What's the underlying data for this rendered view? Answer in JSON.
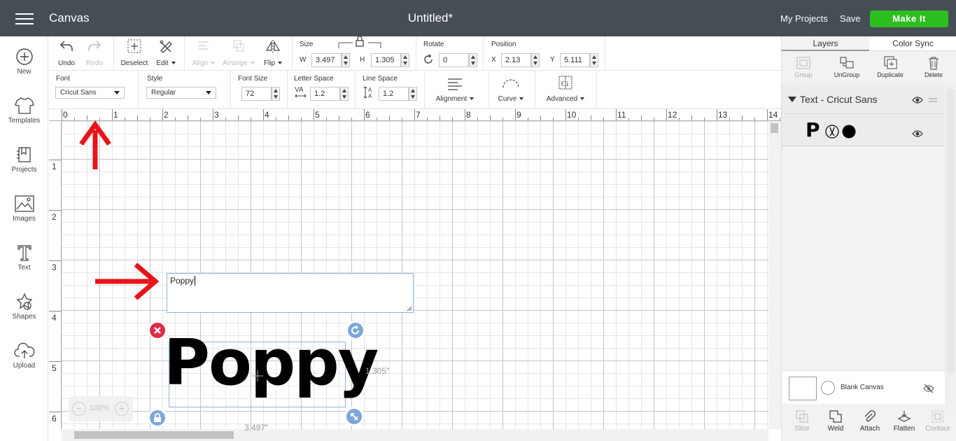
{
  "header": {
    "app_title": "Canvas",
    "document_title": "Untitled*",
    "my_projects": "My Projects",
    "save": "Save",
    "make_it": "Make It"
  },
  "left_sidebar": {
    "items": [
      {
        "label": "New",
        "icon": "plus-circle-icon"
      },
      {
        "label": "Templates",
        "icon": "shirt-icon"
      },
      {
        "label": "Projects",
        "icon": "projects-icon"
      },
      {
        "label": "Images",
        "icon": "image-icon"
      },
      {
        "label": "Text",
        "icon": "text-t-icon"
      },
      {
        "label": "Shapes",
        "icon": "shapes-icon"
      },
      {
        "label": "Upload",
        "icon": "upload-cloud-icon"
      }
    ]
  },
  "toolbar": {
    "undo": "Undo",
    "redo": "Redo",
    "deselect": "Deselect",
    "edit": "Edit",
    "align": "Align",
    "arrange": "Arrange",
    "flip": "Flip",
    "size_label": "Size",
    "width_label": "W",
    "width_value": "3.497",
    "height_label": "H",
    "height_value": "1.305",
    "rotate_label": "Rotate",
    "rotate_value": "0",
    "position_label": "Position",
    "x_label": "X",
    "x_value": "2.13",
    "y_label": "Y",
    "y_value": "5.111",
    "font_label": "Font",
    "font_value": "Cricut Sans",
    "style_label": "Style",
    "style_value": "Regular",
    "font_size_label": "Font Size",
    "font_size_value": "72",
    "letter_space_label": "Letter Space",
    "letter_space_value": "1.2",
    "line_space_label": "Line Space",
    "line_space_value": "1.2",
    "alignment": "Alignment",
    "curve": "Curve",
    "advanced": "Advanced"
  },
  "canvas": {
    "ruler_top": [
      "0",
      "1",
      "2",
      "3",
      "4",
      "5",
      "6",
      "7",
      "8",
      "9",
      "10",
      "11",
      "12",
      "13",
      "14"
    ],
    "ruler_left": [
      "1",
      "2",
      "3",
      "4",
      "5",
      "6"
    ],
    "text_input_value": "Poppy",
    "text_object": "Poppy",
    "height_dimension": "1.305\"",
    "width_dimension": "3.497\"",
    "zoom": "100%"
  },
  "right_panel": {
    "tab_layers": "Layers",
    "tab_color_sync": "Color Sync",
    "group": "Group",
    "ungroup": "UnGroup",
    "duplicate": "Duplicate",
    "delete": "Delete",
    "layer_title": "Text - Cricut Sans",
    "layer_preview_letter": "P",
    "blank_canvas": "Blank Canvas",
    "slice": "Slice",
    "weld": "Weld",
    "attach": "Attach",
    "flatten": "Flatten",
    "contour": "Contour"
  },
  "colors": {
    "header_bg": "#454d55",
    "make_it_green": "#2dbe1f",
    "annotation_red": "#e8141a",
    "delete_handle": "#e0294a",
    "blue_handle": "#7da7d9"
  }
}
